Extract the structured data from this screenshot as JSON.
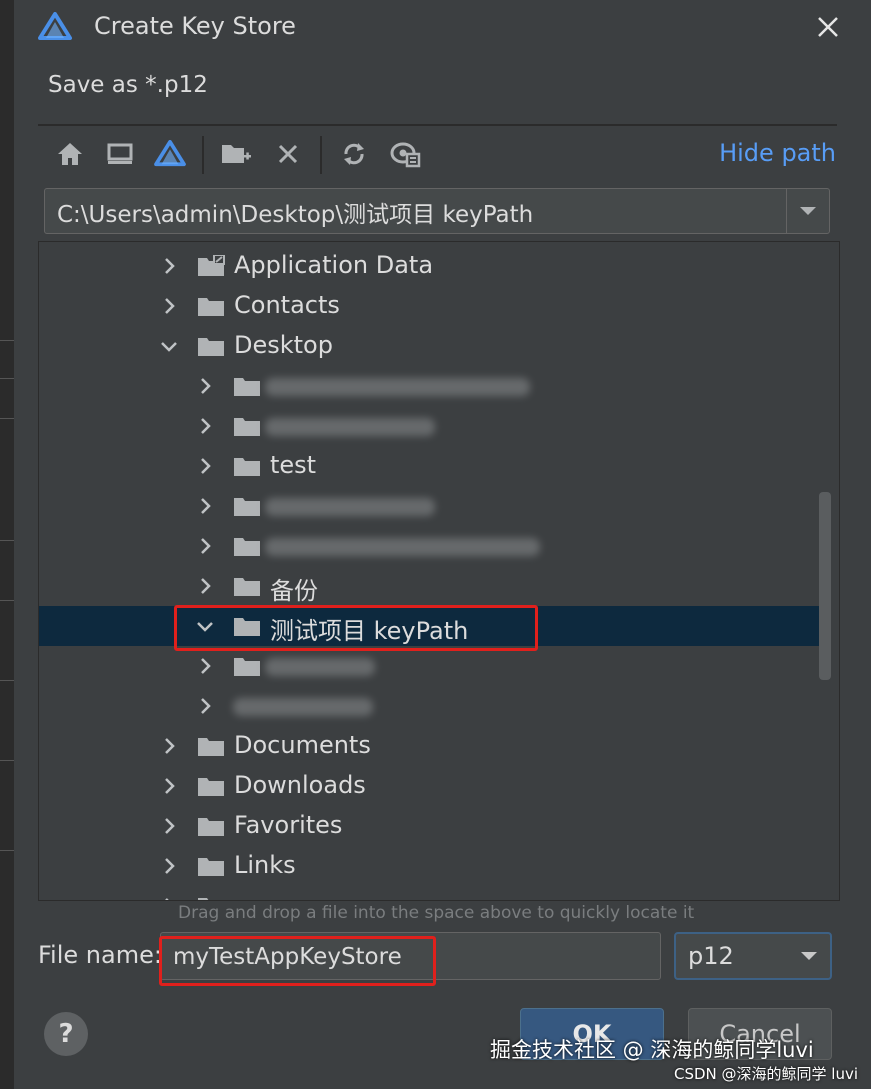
{
  "dialog": {
    "title": "Create Key Store",
    "save_hint": "Save as *.p12",
    "close_icon": "close-icon"
  },
  "toolbar": {
    "icons": [
      "home-icon",
      "desktop-icon",
      "project-icon",
      "new-folder-icon",
      "delete-icon",
      "refresh-icon",
      "show-hidden-icon"
    ],
    "hide_path_label": "Hide path"
  },
  "path": {
    "value": "C:\\Users\\admin\\Desktop\\测试项目 keyPath"
  },
  "tree": {
    "items": [
      {
        "label": "Application Data",
        "level": 0,
        "expanded": false
      },
      {
        "label": "Contacts",
        "level": 0,
        "expanded": false
      },
      {
        "label": "Desktop",
        "level": 0,
        "expanded": true
      },
      {
        "label": "",
        "level": 1,
        "expanded": false,
        "redacted": true
      },
      {
        "label": "",
        "level": 1,
        "expanded": false,
        "redacted": true
      },
      {
        "label": "test",
        "level": 1,
        "expanded": false
      },
      {
        "label": "",
        "level": 1,
        "expanded": false,
        "redacted": true
      },
      {
        "label": "",
        "level": 1,
        "expanded": false,
        "redacted": true
      },
      {
        "label": "备份",
        "level": 1,
        "expanded": false
      },
      {
        "label": "测试项目 keyPath",
        "level": 1,
        "expanded": true,
        "selected": true
      },
      {
        "label": "",
        "level": 1,
        "expanded": false,
        "redacted": true
      },
      {
        "label": "",
        "level": 1,
        "expanded": false,
        "redacted": true
      },
      {
        "label": "Documents",
        "level": 0,
        "expanded": false
      },
      {
        "label": "Downloads",
        "level": 0,
        "expanded": false
      },
      {
        "label": "Favorites",
        "level": 0,
        "expanded": false
      },
      {
        "label": "Links",
        "level": 0,
        "expanded": false
      }
    ]
  },
  "drag_hint": "Drag and drop a file into the space above to quickly locate it",
  "file_name": {
    "label": "File name:",
    "value": "myTestAppKeyStore"
  },
  "extension": {
    "selected": "p12"
  },
  "buttons": {
    "help": "?",
    "ok": "OK",
    "cancel": "Cancel"
  },
  "watermark": {
    "line1": "掘金技术社区 @ 深海的鲸同学luvi",
    "line2": "CSDN @深海的鲸同学 luvi"
  },
  "colors": {
    "background": "#3c3f41",
    "selection": "#0d293e",
    "link": "#589df6",
    "highlight": "#e0201c",
    "ok_button": "#365880"
  }
}
